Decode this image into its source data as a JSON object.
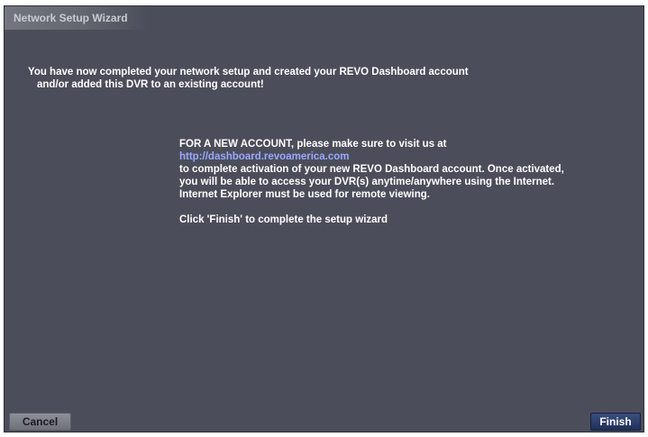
{
  "window": {
    "title": "Network Setup Wizard"
  },
  "message": {
    "line1": "You have now completed your network setup and created your REVO Dashboard account",
    "line2": "and/or added this DVR to an existing account!"
  },
  "info": {
    "line1": "FOR A NEW ACCOUNT, please make sure to visit us at",
    "link": "http://dashboard.revoamerica.com",
    "line3": "to complete activation of your new REVO Dashboard account. Once activated,",
    "line4": "you will be able to access your DVR(s) anytime/anywhere using the Internet.",
    "line5": "Internet Explorer must be used for remote viewing.",
    "line6": "Click 'Finish' to complete the setup wizard"
  },
  "buttons": {
    "cancel": "Cancel",
    "finish": "Finish"
  },
  "colors": {
    "background": "#4b4e5a",
    "link": "#9aa8ff",
    "finish_button": "#1f2f57"
  }
}
